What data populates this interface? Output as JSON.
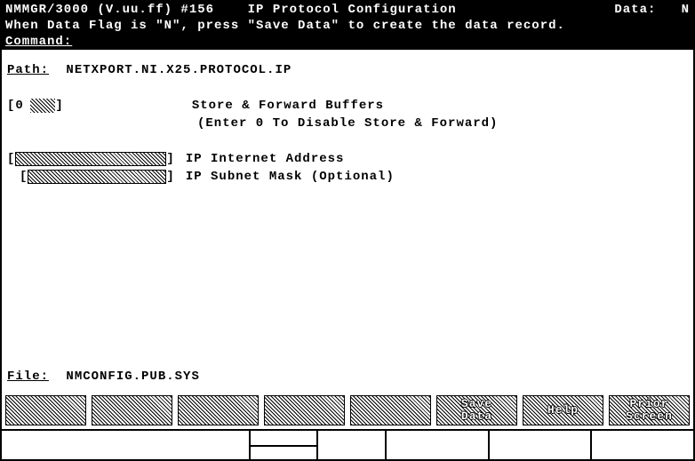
{
  "title": {
    "app": "NMMGR/3000 (V.uu.ff) #156",
    "screen": "IP Protocol Configuration",
    "data_label": "Data:",
    "data_flag": "N"
  },
  "message": "When Data Flag is \"N\", press \"Save Data\" to create the data record.",
  "command_label": "Command:",
  "path_label": "Path:",
  "path_value": "NETXPORT.NI.X25.PROTOCOL.IP",
  "fields": {
    "buffers_value": "0",
    "buffers_label": "Store & Forward Buffers",
    "buffers_hint": "(Enter 0 To Disable Store & Forward)",
    "ip_addr_value": "",
    "ip_addr_label": "IP Internet Address",
    "subnet_value": "",
    "subnet_label": "IP Subnet Mask (Optional)"
  },
  "file_label": "File:",
  "file_value": "NMCONFIG.PUB.SYS",
  "fkeys": {
    "f1": "",
    "f2": "",
    "f3": "",
    "f4": "",
    "f5": "",
    "f6a": "Save",
    "f6b": "Data",
    "f7": "Help",
    "f8a": "Prior",
    "f8b": "Screen"
  }
}
